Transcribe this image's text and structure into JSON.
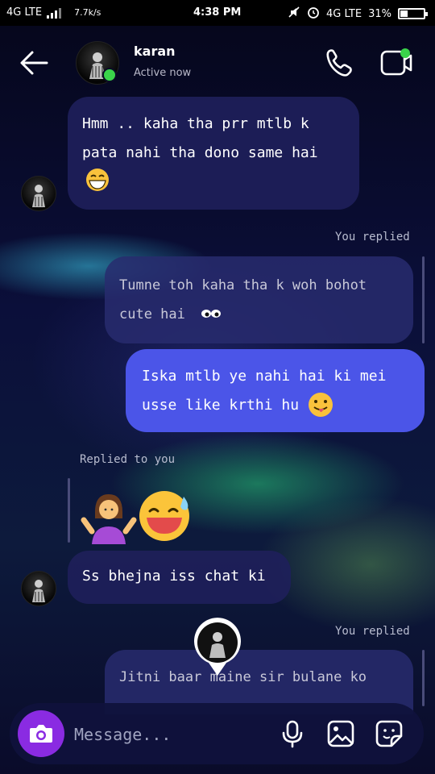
{
  "status_bar": {
    "network_left": "4G LTE",
    "speed": "7.7k/s",
    "time": "4:38 PM",
    "network_right": "4G LTE",
    "battery": "31"
  },
  "header": {
    "contact_name": "karan",
    "contact_status": "Active now"
  },
  "messages": [
    {
      "type": "incoming",
      "text": "Hmm .. kaha tha prr mtlb k pata nahi tha dono same hai"
    },
    {
      "type": "label",
      "text": "You replied"
    },
    {
      "type": "quoted",
      "text": "Tumne toh kaha tha k woh bohot cute hai"
    },
    {
      "type": "outgoing",
      "text": "Iska mtlb ye nahi hai ki mei usse like krthi hu"
    },
    {
      "type": "label",
      "text": "Replied to you"
    },
    {
      "type": "incoming",
      "text": "Ss bhejna iss chat ki"
    },
    {
      "type": "label",
      "text": "You replied"
    },
    {
      "type": "quoted",
      "text": "Jitni baar maine sir bulane ko"
    }
  ],
  "composer": {
    "placeholder": "Message..."
  },
  "colors": {
    "outgoing_bubble": "#4b55e8",
    "incoming_bubble": "#1e205a",
    "camera_button": "#8a2be2",
    "online": "#3ad44a"
  },
  "icons": [
    "back-arrow-icon",
    "phone-icon",
    "video-call-icon",
    "camera-icon",
    "microphone-icon",
    "gallery-icon",
    "sticker-icon"
  ]
}
